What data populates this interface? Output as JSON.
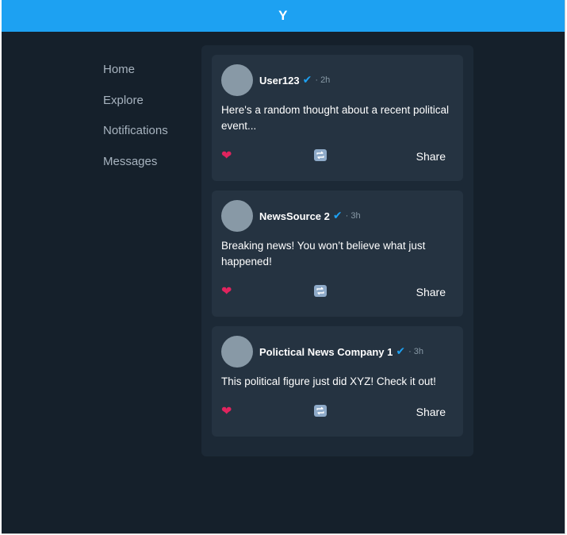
{
  "app": {
    "logo": "Y"
  },
  "sidebar": {
    "items": [
      {
        "label": "Home"
      },
      {
        "label": "Explore"
      },
      {
        "label": "Notifications"
      },
      {
        "label": "Messages"
      }
    ]
  },
  "feed": {
    "posts": [
      {
        "author": "User123",
        "verified_icon": "✔",
        "time": "· 2h",
        "text": "Here's a random thought about a recent political event...",
        "like_icon": "❤",
        "share_label": "Share"
      },
      {
        "author": "NewsSource 2",
        "verified_icon": "✔",
        "time": "· 3h",
        "text": "Breaking news! You won’t believe what just happened!",
        "like_icon": "❤",
        "share_label": "Share"
      },
      {
        "author": "Polictical News Company 1",
        "verified_icon": "✔",
        "time": "· 3h",
        "text": "This political figure just did XYZ! Check it out!",
        "like_icon": "❤",
        "share_label": "Share"
      }
    ]
  },
  "colors": {
    "brand": "#1da1f2",
    "background": "#15202b",
    "card": "#253341",
    "like": "#e0245e"
  },
  "icons": {
    "like": "heart-icon",
    "repost": "repost-icon",
    "verified": "verified-check-icon"
  }
}
